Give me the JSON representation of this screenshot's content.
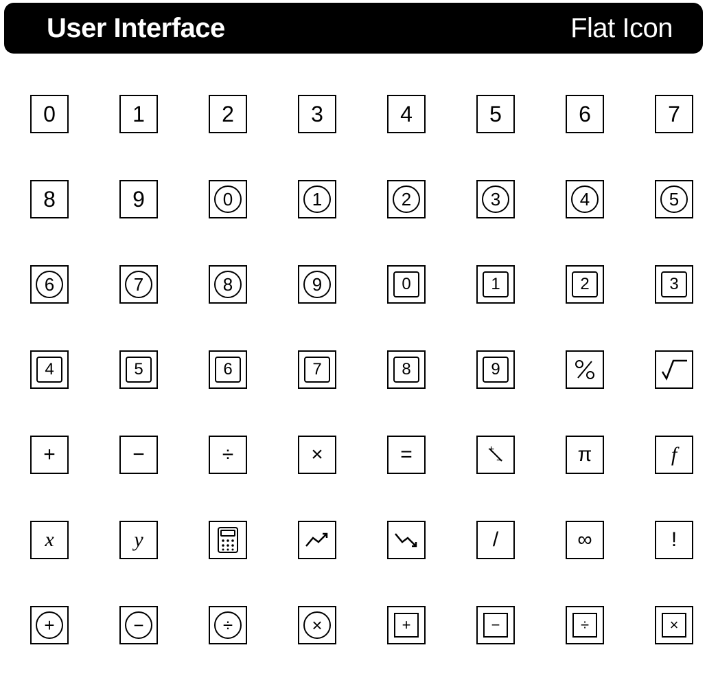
{
  "header": {
    "left": "User Interface",
    "right": "Flat Icon"
  },
  "icons": [
    [
      {
        "name": "digit-0-icon",
        "style": "plain",
        "glyph": "0"
      },
      {
        "name": "digit-1-icon",
        "style": "plain",
        "glyph": "1"
      },
      {
        "name": "digit-2-icon",
        "style": "plain",
        "glyph": "2"
      },
      {
        "name": "digit-3-icon",
        "style": "plain",
        "glyph": "3"
      },
      {
        "name": "digit-4-icon",
        "style": "plain",
        "glyph": "4"
      },
      {
        "name": "digit-5-icon",
        "style": "plain",
        "glyph": "5"
      },
      {
        "name": "digit-6-icon",
        "style": "plain",
        "glyph": "6"
      },
      {
        "name": "digit-7-icon",
        "style": "plain",
        "glyph": "7"
      }
    ],
    [
      {
        "name": "digit-8-icon",
        "style": "plain",
        "glyph": "8"
      },
      {
        "name": "digit-9-icon",
        "style": "plain",
        "glyph": "9"
      },
      {
        "name": "circled-0-icon",
        "style": "circle",
        "glyph": "0"
      },
      {
        "name": "circled-1-icon",
        "style": "circle",
        "glyph": "1"
      },
      {
        "name": "circled-2-icon",
        "style": "circle",
        "glyph": "2"
      },
      {
        "name": "circled-3-icon",
        "style": "circle",
        "glyph": "3"
      },
      {
        "name": "circled-4-icon",
        "style": "circle",
        "glyph": "4"
      },
      {
        "name": "circled-5-icon",
        "style": "circle",
        "glyph": "5"
      }
    ],
    [
      {
        "name": "circled-6-icon",
        "style": "circle",
        "glyph": "6"
      },
      {
        "name": "circled-7-icon",
        "style": "circle",
        "glyph": "7"
      },
      {
        "name": "circled-8-icon",
        "style": "circle",
        "glyph": "8"
      },
      {
        "name": "circled-9-icon",
        "style": "circle",
        "glyph": "9"
      },
      {
        "name": "squared-0-icon",
        "style": "square",
        "glyph": "0"
      },
      {
        "name": "squared-1-icon",
        "style": "square",
        "glyph": "1"
      },
      {
        "name": "squared-2-icon",
        "style": "square",
        "glyph": "2"
      },
      {
        "name": "squared-3-icon",
        "style": "square",
        "glyph": "3"
      }
    ],
    [
      {
        "name": "squared-4-icon",
        "style": "square",
        "glyph": "4"
      },
      {
        "name": "squared-5-icon",
        "style": "square",
        "glyph": "5"
      },
      {
        "name": "squared-6-icon",
        "style": "square",
        "glyph": "6"
      },
      {
        "name": "squared-7-icon",
        "style": "square",
        "glyph": "7"
      },
      {
        "name": "squared-8-icon",
        "style": "square",
        "glyph": "8"
      },
      {
        "name": "squared-9-icon",
        "style": "square",
        "glyph": "9"
      },
      {
        "name": "percent-icon",
        "style": "svg",
        "svg": "percent"
      },
      {
        "name": "square-root-icon",
        "style": "svg",
        "svg": "sqrt"
      }
    ],
    [
      {
        "name": "plus-icon",
        "style": "op",
        "glyph": "+"
      },
      {
        "name": "minus-icon",
        "style": "op",
        "glyph": "−"
      },
      {
        "name": "divide-icon",
        "style": "op",
        "glyph": "÷"
      },
      {
        "name": "multiply-icon",
        "style": "op",
        "glyph": "×"
      },
      {
        "name": "equals-icon",
        "style": "op",
        "glyph": "="
      },
      {
        "name": "plus-minus-icon",
        "style": "svg",
        "svg": "plusminus"
      },
      {
        "name": "pi-icon",
        "style": "op",
        "glyph": "π"
      },
      {
        "name": "function-f-icon",
        "style": "italic",
        "glyph": "f"
      }
    ],
    [
      {
        "name": "variable-x-icon",
        "style": "italic",
        "glyph": "x"
      },
      {
        "name": "variable-y-icon",
        "style": "italic",
        "glyph": "y"
      },
      {
        "name": "calculator-icon",
        "style": "svg",
        "svg": "calc"
      },
      {
        "name": "trend-up-icon",
        "style": "svg",
        "svg": "up"
      },
      {
        "name": "trend-down-icon",
        "style": "svg",
        "svg": "down"
      },
      {
        "name": "slash-icon",
        "style": "op",
        "glyph": "/"
      },
      {
        "name": "infinity-icon",
        "style": "op",
        "glyph": "∞"
      },
      {
        "name": "exclamation-icon",
        "style": "op",
        "glyph": "!"
      }
    ],
    [
      {
        "name": "circled-plus-icon",
        "style": "circle",
        "glyph": "+"
      },
      {
        "name": "circled-minus-icon",
        "style": "circle",
        "glyph": "−"
      },
      {
        "name": "circled-divide-icon",
        "style": "circle",
        "glyph": "÷"
      },
      {
        "name": "circled-multiply-icon",
        "style": "circle",
        "glyph": "×"
      },
      {
        "name": "boxed-plus-icon",
        "style": "sqsharp",
        "glyph": "+"
      },
      {
        "name": "boxed-minus-icon",
        "style": "sqsharp",
        "glyph": "−"
      },
      {
        "name": "boxed-divide-icon",
        "style": "sqsharp",
        "glyph": "÷"
      },
      {
        "name": "boxed-multiply-icon",
        "style": "sqsharp",
        "glyph": "×"
      }
    ]
  ]
}
